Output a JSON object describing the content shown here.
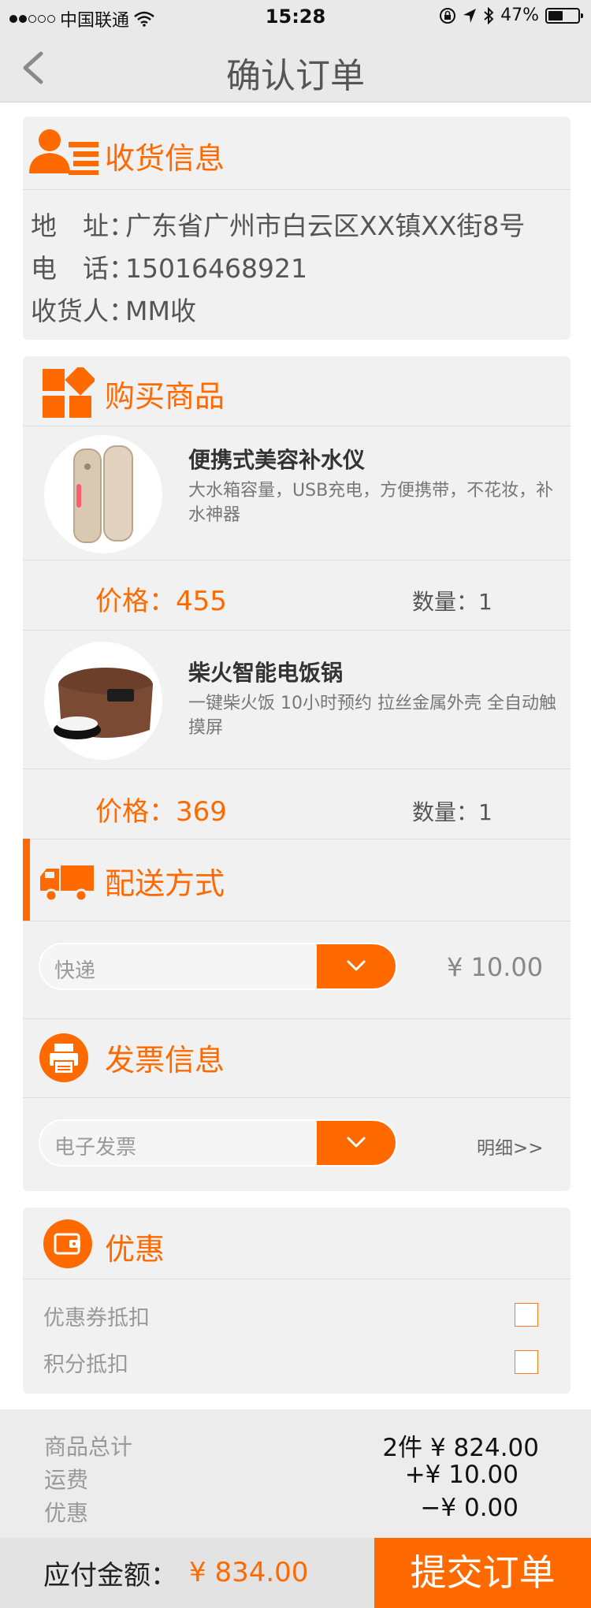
{
  "status_bar": {
    "carrier": "中国联通",
    "time": "15:28",
    "battery": "47%",
    "battery_level": 0.47
  },
  "nav": {
    "title": "确认订单",
    "back_icon": "chevron-left-icon"
  },
  "shipping_info": {
    "section_title": "收货信息",
    "icon": "user-list-icon",
    "address_label": "地　址：",
    "address": "广东省广州市白云区XX镇XX街8号",
    "phone_label": "电　话：",
    "phone": "15016468921",
    "receiver_label": "收货人：",
    "receiver": "MM收"
  },
  "products": {
    "section_title": "购买商品",
    "icon": "grid-icon",
    "items": [
      {
        "name": "便携式美容补水仪",
        "description": "大水箱容量，USB充电，方便携带，不花妆，补水神器",
        "price_label": "价格：",
        "price": "455",
        "qty_label": "数量：",
        "qty": "1"
      },
      {
        "name": "柴火智能电饭锅",
        "description": "一键柴火饭 10小时预约 拉丝金属外壳 全自动触摸屏",
        "price_label": "价格：",
        "price": "369",
        "qty_label": "数量：",
        "qty": "1"
      }
    ]
  },
  "delivery": {
    "section_title": "配送方式",
    "icon": "truck-icon",
    "selected": "快递",
    "fee": "¥ 10.00"
  },
  "invoice": {
    "section_title": "发票信息",
    "icon": "printer-icon",
    "selected": "电子发票",
    "detail_link": "明细>>"
  },
  "discount": {
    "section_title": "优惠",
    "icon": "wallet-icon",
    "options": [
      {
        "label": "优惠券抵扣",
        "checked": false
      },
      {
        "label": "积分抵扣",
        "checked": false
      }
    ]
  },
  "summary": {
    "items_total_label": "商品总计",
    "items_total": "2件 ¥ 824.00",
    "shipping_label": "运费",
    "shipping": "+¥ 10.00",
    "discount_label": "优惠",
    "discount": "−¥ 0.00"
  },
  "footer": {
    "payable_label": "应付金额：",
    "payable": "¥ 834.00",
    "submit": "提交订单"
  },
  "colors": {
    "accent": "#ff6a00",
    "card_bg": "#f1f1f1",
    "page_bg": "#ffffff",
    "nav_bg": "#e9e9e9"
  }
}
